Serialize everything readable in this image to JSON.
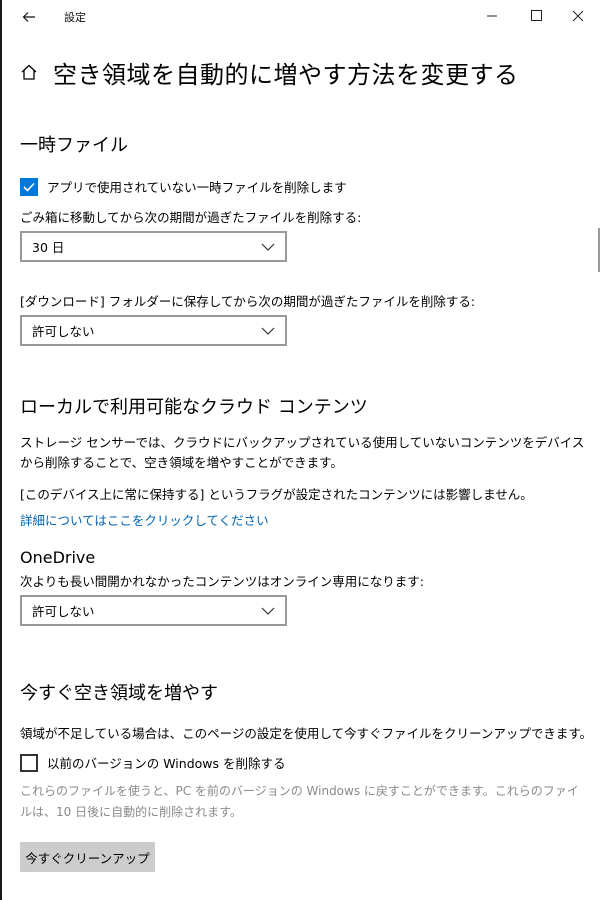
{
  "window": {
    "app_title": "設定",
    "back_icon": "back-arrow-icon",
    "minimize_glyph": "—",
    "maximize_glyph": "☐",
    "close_glyph": "✕"
  },
  "header": {
    "icon": "home-icon",
    "title": "空き領域を自動的に増やす方法を変更する"
  },
  "temp_files": {
    "title": "一時ファイル",
    "delete_unused_checkbox": {
      "label": "アプリで使用されていない一時ファイルを削除します",
      "checked": true
    },
    "recycle_bin_label": "ごみ箱に移動してから次の期間が過ぎたファイルを削除する:",
    "recycle_bin_value": "30 日",
    "downloads_label": "[ダウンロード] フォルダーに保存してから次の期間が過ぎたファイルを削除する:",
    "downloads_value": "許可しない"
  },
  "cloud_content": {
    "title": "ローカルで利用可能なクラウド コンテンツ",
    "description": "ストレージ センサーでは、クラウドにバックアップされている使用していないコンテンツをデバイスから削除することで、空き領域を増やすことができます。",
    "note": "[このデバイス上に常に保持する] というフラグが設定されたコンテンツには影響しません。",
    "link": "詳細についてはここをクリックしてください",
    "onedrive_title": "OneDrive",
    "onedrive_label": "次よりも長い間開かれなかったコンテンツはオンライン専用になります:",
    "onedrive_value": "許可しない"
  },
  "free_now": {
    "title": "今すぐ空き領域を増やす",
    "description": "領域が不足している場合は、このページの設定を使用して今すぐファイルをクリーンアップできます。",
    "previous_windows_checkbox": {
      "label": "以前のバージョンの Windows を削除する",
      "checked": false
    },
    "previous_windows_note": "これらのファイルを使うと、PC を前のバージョンの Windows に戻すことができます。これらのファイルは、10 日後に自動的に削除されます。",
    "cleanup_button": "今すぐクリーンアップ"
  },
  "colors": {
    "accent": "#0078d7",
    "link": "#0063b1",
    "muted_text": "#8a8a8a",
    "button_bg": "#cccccc"
  }
}
